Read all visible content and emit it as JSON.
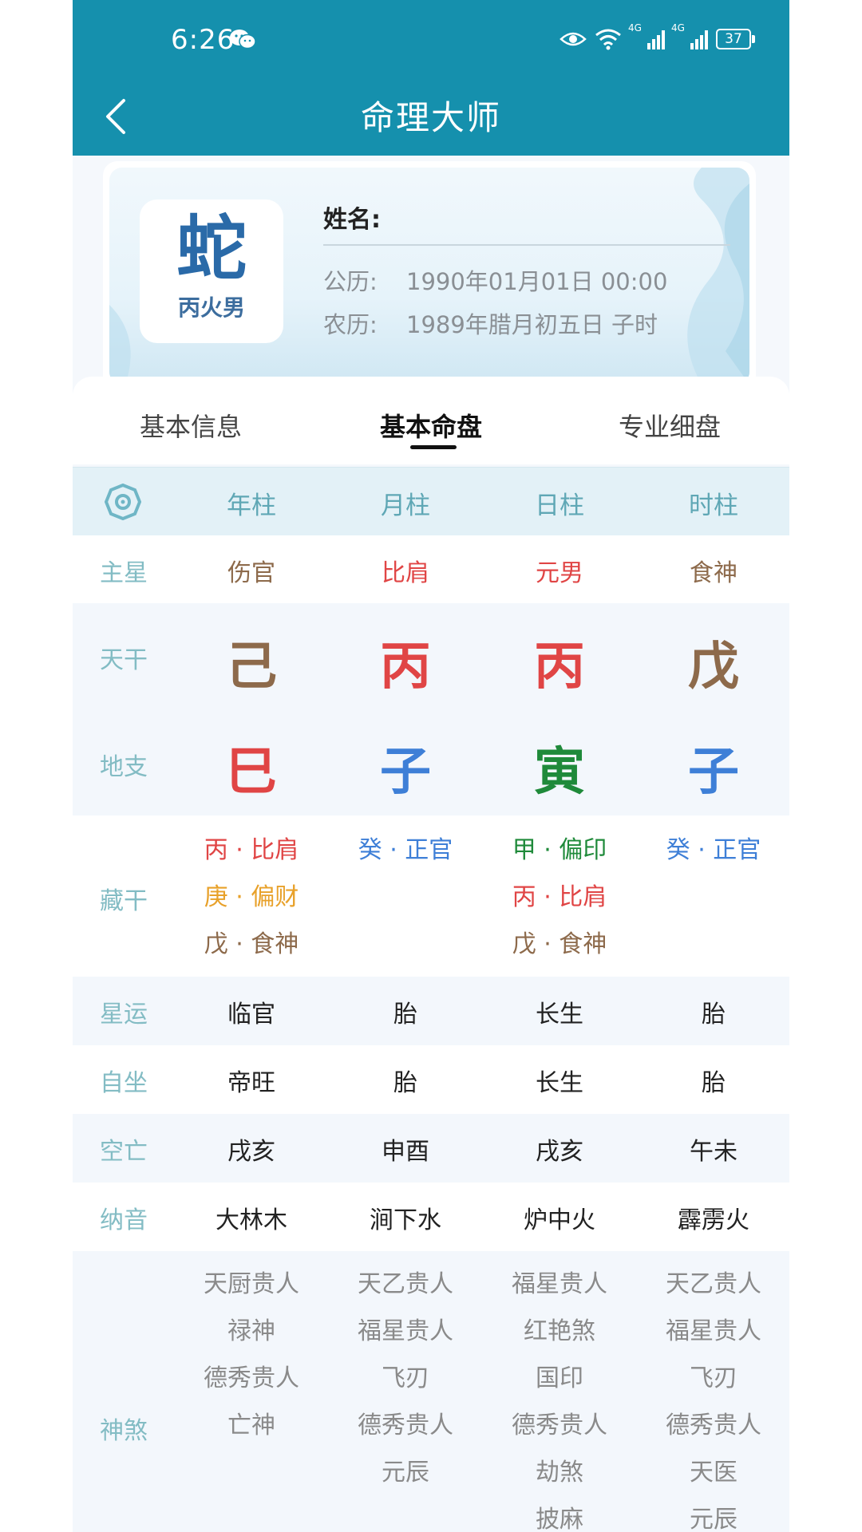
{
  "status": {
    "time": "6:26",
    "net1": "4G",
    "net2": "4G",
    "battery": "37"
  },
  "nav": {
    "title": "命理大师"
  },
  "profile": {
    "zodiac": "蛇",
    "zodiac_sub": "丙火男",
    "name_label": "姓名:",
    "name_value": "",
    "solar_label": "公历:",
    "solar_value": "1990年01月01日 00:00",
    "lunar_label": "农历:",
    "lunar_value": "1989年腊月初五日 子时"
  },
  "tabs": [
    {
      "label": "基本信息",
      "active": false
    },
    {
      "label": "基本命盘",
      "active": true
    },
    {
      "label": "专业细盘",
      "active": false
    }
  ],
  "columns": [
    "年柱",
    "月柱",
    "日柱",
    "时柱"
  ],
  "rows": {
    "zhuxing": {
      "label": "主星",
      "values": [
        "伤官",
        "比肩",
        "元男",
        "食神"
      ],
      "colors": [
        "#8d6a4b",
        "#e04545",
        "#e04545",
        "#8d6a4b"
      ]
    },
    "tiangan": {
      "label": "天干",
      "values": [
        "己",
        "丙",
        "丙",
        "戊"
      ],
      "colors": [
        "#8d6a4b",
        "#e04545",
        "#e04545",
        "#8d6a4b"
      ]
    },
    "dizhi": {
      "label": "地支",
      "values": [
        "巳",
        "子",
        "寅",
        "子"
      ],
      "colors": [
        "#e04545",
        "#3e7fd7",
        "#1f8a3a",
        "#3e7fd7"
      ]
    },
    "canggan": {
      "label": "藏干",
      "values": [
        [
          {
            "t": "丙 · 比肩",
            "c": "#e04545"
          },
          {
            "t": "庚 · 偏财",
            "c": "#e8a12a"
          },
          {
            "t": "戊 · 食神",
            "c": "#8d6a4b"
          }
        ],
        [
          {
            "t": "癸 · 正官",
            "c": "#3e7fd7"
          }
        ],
        [
          {
            "t": "甲 · 偏印",
            "c": "#1f8a3a"
          },
          {
            "t": "丙 · 比肩",
            "c": "#e04545"
          },
          {
            "t": "戊 · 食神",
            "c": "#8d6a4b"
          }
        ],
        [
          {
            "t": "癸 · 正官",
            "c": "#3e7fd7"
          }
        ]
      ]
    },
    "xingyun": {
      "label": "星运",
      "values": [
        "临官",
        "胎",
        "长生",
        "胎"
      ]
    },
    "zizuo": {
      "label": "自坐",
      "values": [
        "帝旺",
        "胎",
        "长生",
        "胎"
      ]
    },
    "kongwang": {
      "label": "空亡",
      "values": [
        "戌亥",
        "申酉",
        "戌亥",
        "午未"
      ]
    },
    "nayin": {
      "label": "纳音",
      "values": [
        "大林木",
        "涧下水",
        "炉中火",
        "霹雳火"
      ]
    },
    "shensha": {
      "label": "神煞",
      "values": [
        [
          "天厨贵人",
          "禄神",
          "德秀贵人",
          "亡神"
        ],
        [
          "天乙贵人",
          "福星贵人",
          "飞刃",
          "德秀贵人",
          "元辰"
        ],
        [
          "福星贵人",
          "红艳煞",
          "国印",
          "德秀贵人",
          "劫煞",
          "披麻"
        ],
        [
          "天乙贵人",
          "福星贵人",
          "飞刃",
          "德秀贵人",
          "天医",
          "元辰"
        ]
      ]
    }
  }
}
